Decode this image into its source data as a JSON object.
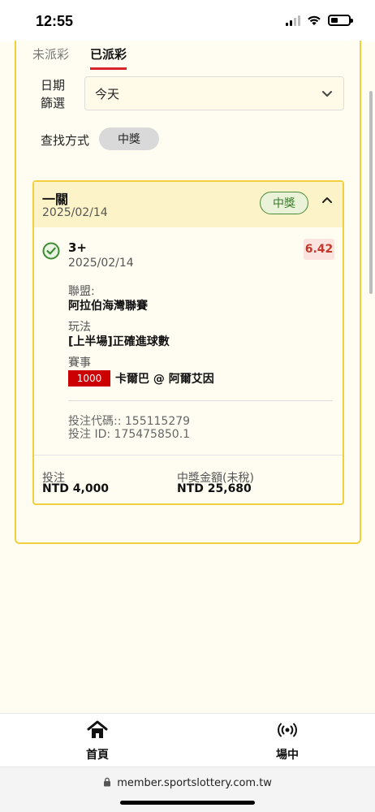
{
  "status_bar": {
    "time": "12:55"
  },
  "tabs": [
    {
      "label": "未派彩",
      "active": false
    },
    {
      "label": "已派彩",
      "active": true
    }
  ],
  "filter": {
    "date_label": "日期篩選",
    "date_value": "今天",
    "search_label": "查找方式",
    "search_pill": "中獎"
  },
  "bet": {
    "type": "一關",
    "date": "2025/02/14",
    "status_badge": "中獎",
    "selection": {
      "name": "3+",
      "date": "2025/02/14",
      "odds": "6.42",
      "league_label": "聯盟:",
      "league": "阿拉伯海灣聯賽",
      "market_label": "玩法",
      "market": "[上半場]正確進球數",
      "event_label": "賽事",
      "event_code": "1000",
      "event_name": "卡爾巴 @ 阿爾艾因"
    },
    "bet_code": "投注代碼:: 155115279",
    "bet_id": "投注 ID: 175475850.1",
    "stake_label": "投注",
    "stake": "NTD 4,000",
    "payout_label": "中獎金額(未稅)",
    "payout": "NTD 25,680"
  },
  "bottom_nav": [
    {
      "label": "首頁",
      "icon": "home-icon"
    },
    {
      "label": "場中",
      "icon": "live-icon"
    }
  ],
  "browser": {
    "url": "member.sportslottery.com.tw"
  },
  "colors": {
    "accent_yellow": "#f2cf3d",
    "tab_underline": "#d7262a",
    "win_green": "#3a7a2a",
    "odds_red": "#c0392b",
    "event_red": "#cc0000"
  }
}
